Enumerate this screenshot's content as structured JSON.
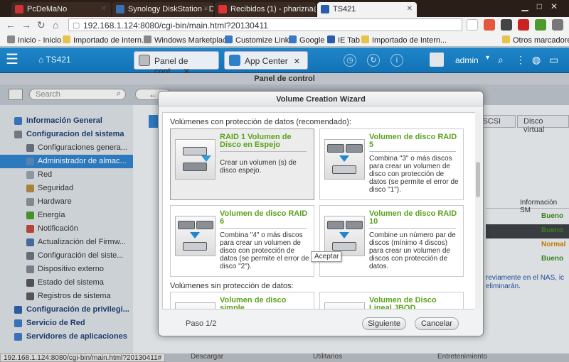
{
  "browser": {
    "tabs": [
      {
        "label": "PcDeMaNo",
        "active": false
      },
      {
        "label": "Synology DiskStation - DS",
        "active": false
      },
      {
        "label": "Recibidos (1) - pharizna@",
        "active": false
      },
      {
        "label": "TS421",
        "active": true
      }
    ],
    "url": "192.168.1.124:8080/cgi-bin/main.html?20130411",
    "bookmarks": [
      "Inicio - Inicio",
      "Importado de Intern...",
      "Windows Marketplace",
      "Customize Links",
      "Google",
      "IE Tab",
      "Importado de Intern...",
      "Otros marcadores"
    ],
    "status_url": "192.168.1.124:8080/cgi-bin/main.html?20130411#"
  },
  "qnap": {
    "home_label": "TS421",
    "tabs": [
      {
        "label": "Panel de cont...",
        "close": "✕"
      },
      {
        "label": "App Center",
        "close": "✕"
      }
    ],
    "user": "admin"
  },
  "panel": {
    "title": "Panel de control",
    "search_placeholder": "Search",
    "sidebar": [
      {
        "label": "Información General",
        "type": "group"
      },
      {
        "label": "Configuracion del sistema",
        "type": "group"
      },
      {
        "label": "Configuraciones genera...",
        "type": "sub"
      },
      {
        "label": "Administrador de almac...",
        "type": "sub",
        "selected": true
      },
      {
        "label": "Red",
        "type": "sub"
      },
      {
        "label": "Seguridad",
        "type": "sub"
      },
      {
        "label": "Hardware",
        "type": "sub"
      },
      {
        "label": "Energía",
        "type": "sub"
      },
      {
        "label": "Notificación",
        "type": "sub"
      },
      {
        "label": "Actualización del Firmw...",
        "type": "sub"
      },
      {
        "label": "Configuración del siste...",
        "type": "sub"
      },
      {
        "label": "Dispositivo externo",
        "type": "sub"
      },
      {
        "label": "Estado del sistema",
        "type": "sub"
      },
      {
        "label": "Registros de sistema",
        "type": "sub"
      },
      {
        "label": "Configuración de privilegi...",
        "type": "group"
      },
      {
        "label": "Servicio de Red",
        "type": "group"
      },
      {
        "label": "Servidores de aplicaciones",
        "type": "group"
      }
    ],
    "content_tabs": [
      "iSCSI",
      "Disco virtual"
    ],
    "info_header": "Información SM",
    "statuses": [
      "Bueno",
      "Bueno",
      "Normal",
      "Bueno"
    ],
    "note_lines": [
      "reviamente en el NAS, ic",
      "eliminarán."
    ],
    "taskbar": [
      "Descargar",
      "Utilitarios",
      "Entretenimiento"
    ]
  },
  "wizard": {
    "title": "Volume Creation Wizard",
    "section_protected": "Volúmenes con protección de datos (recomendado):",
    "section_unprotected": "Volúmenes sin protección de datos:",
    "cards": [
      {
        "title": "RAID 1 Volumen de Disco en Espejo",
        "desc": "Crear un volumen (s) de disco espejo."
      },
      {
        "title": "Volumen de disco RAID 5",
        "desc": "Combina \"3\" o más discos para crear un volumen de disco con protección de datos (se permite el error de disco \"1\")."
      },
      {
        "title": "Volumen de disco RAID 6",
        "desc": "Combina \"4\" o más discos para crear un volumen de disco con protección de datos (se permite el error de disco \"2\")."
      },
      {
        "title": "Volumen de disco RAID 10",
        "desc": "Combine un número par de discos (mínimo 4 discos) para crear un volumen de discos con protección de datos."
      },
      {
        "title": "Volumen de disco simple",
        "desc": ""
      },
      {
        "title": "Volumen de Disco Lineal JBOD",
        "desc": ""
      }
    ],
    "step": "Paso 1/2",
    "next_label": "Siguiente",
    "cancel_label": "Cancelar",
    "tooltip": "Aceptar"
  }
}
